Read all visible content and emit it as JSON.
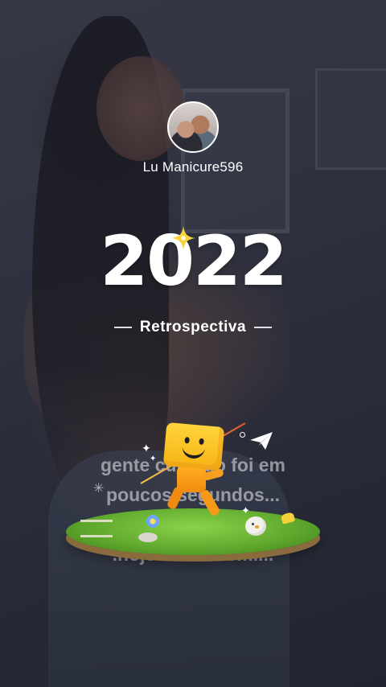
{
  "profile": {
    "username": "Lu Manicure596"
  },
  "hero": {
    "year": "2022",
    "subtitle": "Retrospectiva"
  },
  "caption": {
    "lines": [
      "gente cuidado foi em",
      "poucos segundos...",
      "bobeira..queimaduras",
      ".hoje estou bem...."
    ]
  },
  "icons": {
    "sparkle": "sparkle-icon",
    "paper_plane": "paper-plane-icon",
    "mascot": "mascot-robot-illustration",
    "avatar": "avatar"
  },
  "colors": {
    "text": "#ffffff",
    "sparkle": "#f7d23a",
    "mascot": "#ffc21c"
  }
}
